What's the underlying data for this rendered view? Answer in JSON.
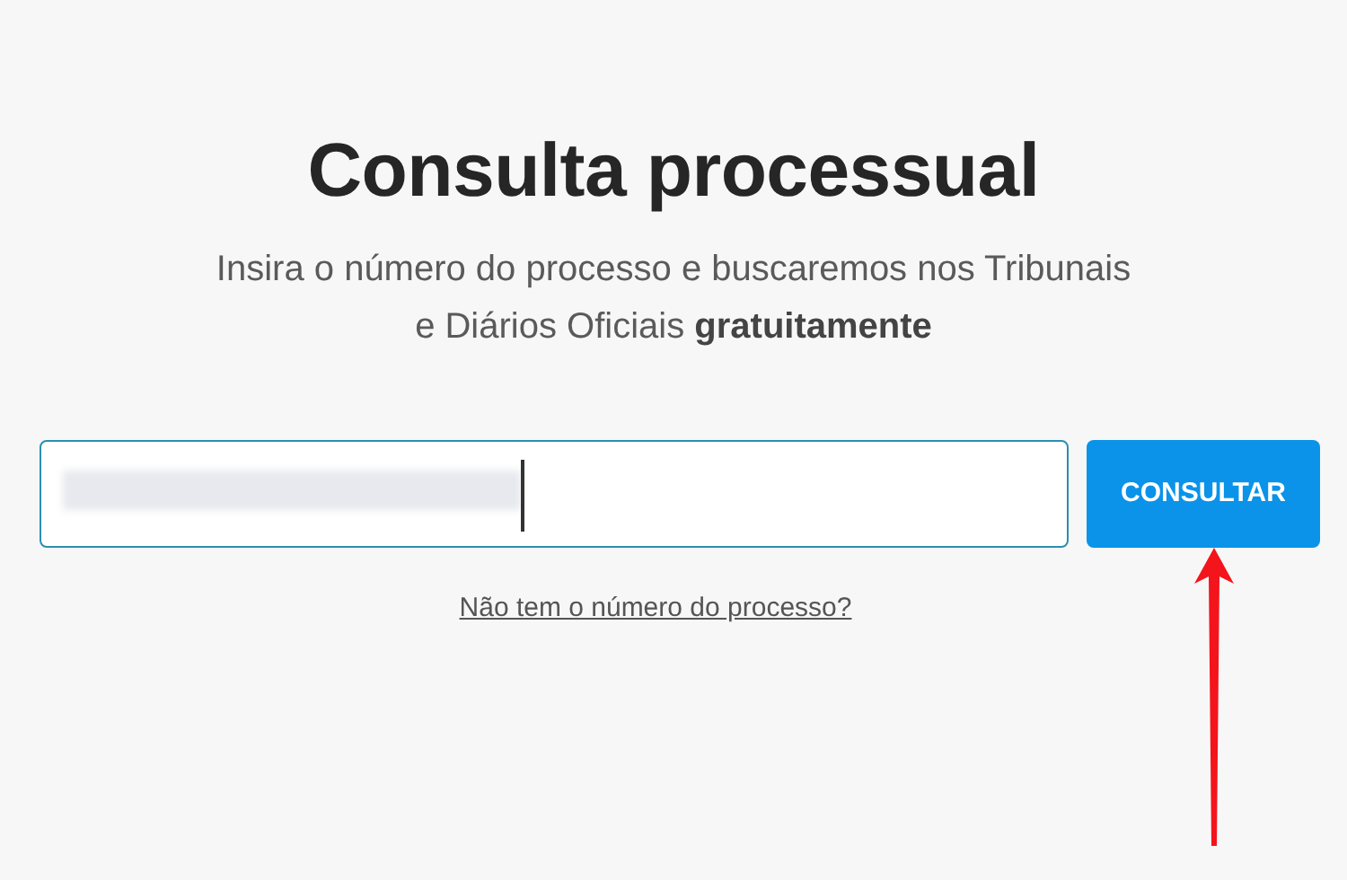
{
  "title": "Consulta processual",
  "subtitle": "Insira o número do processo e buscaremos nos Tribunais e Diários Oficiais **gratuitamente**",
  "search": {
    "value_redacted": true,
    "focused": true
  },
  "button": "CONSULTAR",
  "help_link": "Não tem o número do processo?",
  "annotations": [
    {
      "kind": "arrow"
    }
  ]
}
